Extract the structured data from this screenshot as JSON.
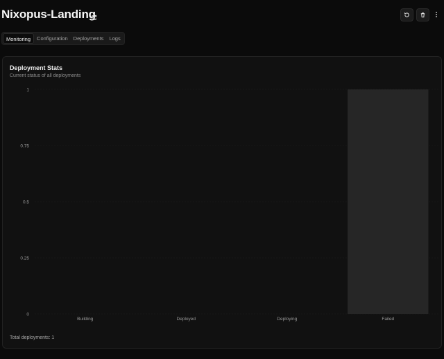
{
  "app": {
    "title": "Nixopus-Landing"
  },
  "header_actions": {
    "refresh_icon": "refresh-icon",
    "delete_icon": "trash-icon",
    "more_icon": "more-vertical-icon"
  },
  "tabs": [
    {
      "label": "Monitoring",
      "active": true
    },
    {
      "label": "Configuration",
      "active": false
    },
    {
      "label": "Deployments",
      "active": false
    },
    {
      "label": "Logs",
      "active": false
    }
  ],
  "card": {
    "title": "Deployment Stats",
    "subtitle": "Current status of all deployments",
    "total_label": "Total deployments: 1"
  },
  "chart_data": {
    "type": "bar",
    "categories": [
      "Building",
      "Deployed",
      "Deploying",
      "Failed"
    ],
    "values": [
      0,
      0,
      0,
      1
    ],
    "yticks": [
      "0",
      "0.25",
      "0.5",
      "0.75",
      "1"
    ],
    "ylim": [
      0,
      1
    ],
    "grid": true,
    "bar_color": "#262626",
    "grid_color": "#1c1c1c",
    "tick_color": "#9a9a9a"
  },
  "colors": {
    "background": "#0b0b0b",
    "card": "#111111",
    "text": "#f0f0f0",
    "muted": "#8c8c8c"
  }
}
